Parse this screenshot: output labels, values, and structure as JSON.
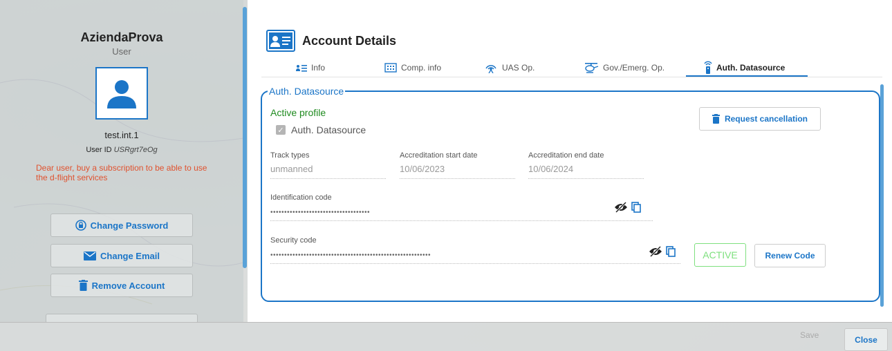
{
  "profile": {
    "company": "AziendaProva",
    "role": "User",
    "username": "test.int.1",
    "user_id_label": "User ID",
    "user_id_value": "USRgrt7eOg",
    "warning": "Dear user, buy a subscription to be able to use the d-flight services",
    "buttons": {
      "change_password": "Change Password",
      "change_email": "Change Email",
      "remove_account": "Remove Account"
    }
  },
  "header": {
    "title": "Account Details"
  },
  "tabs": [
    {
      "label": "Info",
      "icon": "list-user-icon"
    },
    {
      "label": "Comp. info",
      "icon": "building-icon"
    },
    {
      "label": "UAS Op.",
      "icon": "antenna-icon"
    },
    {
      "label": "Gov./Emerg. Op.",
      "icon": "helicopter-icon"
    },
    {
      "label": "Auth. Datasource",
      "icon": "transmitter-icon",
      "active": true
    }
  ],
  "panel": {
    "legend": "Auth. Datasource",
    "active_profile": "Active profile",
    "checkbox_label": "Auth. Datasource",
    "checkbox_checked": true,
    "request_cancellation": "Request cancellation",
    "fields": {
      "track_types": {
        "label": "Track types",
        "value": "unmanned"
      },
      "start_date": {
        "label": "Accreditation start date",
        "value": "10/06/2023"
      },
      "end_date": {
        "label": "Accreditation end date",
        "value": "10/06/2024"
      },
      "identification_code": {
        "label": "Identification code",
        "value": "••••••••••••••••••••••••••••••••••••"
      },
      "security_code": {
        "label": "Security code",
        "value": "••••••••••••••••••••••••••••••••••••••••••••••••••••••••••"
      }
    },
    "status_badge": "ACTIVE",
    "renew_code": "Renew Code"
  },
  "footer": {
    "save": "Save",
    "close": "Close"
  },
  "colors": {
    "accent": "#1b75c7",
    "success": "#1e8a1e",
    "warning": "#e0522f",
    "active_badge": "#7ee07e"
  }
}
